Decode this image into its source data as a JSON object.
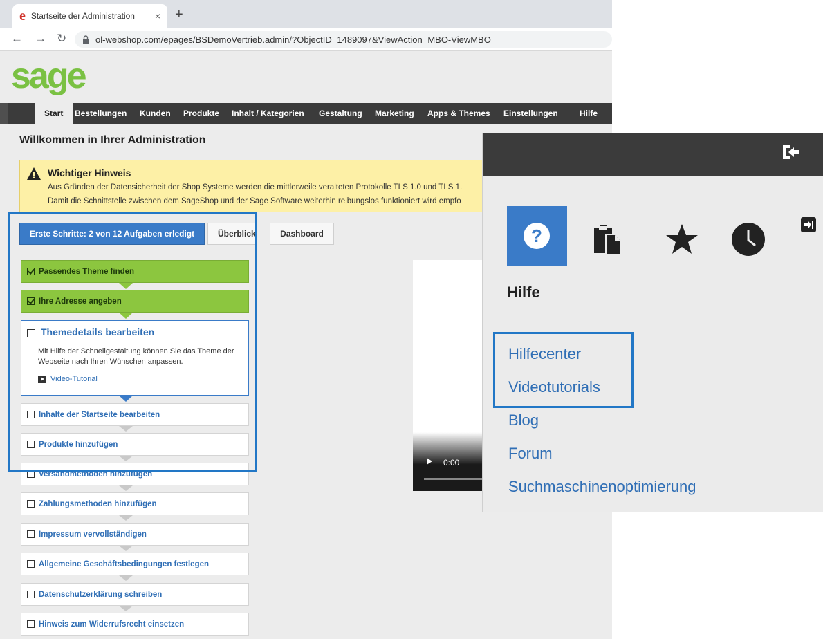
{
  "browser": {
    "tab_title": "Startseite der Administration",
    "tab_favicon": "e",
    "close_glyph": "×",
    "newtab_glyph": "+",
    "url": "ol-webshop.com/epages/BSDemoVertrieb.admin/?ObjectID=1489097&ViewAction=MBO-ViewMBO"
  },
  "logo": "sage",
  "nav": [
    "Start",
    "Bestellungen",
    "Kunden",
    "Produkte",
    "Inhalt / Kategorien",
    "Gestaltung",
    "Marketing",
    "Apps & Themes",
    "Einstellungen",
    "Hilfe"
  ],
  "welcome_title": "Willkommen in Ihrer Administration",
  "notice": {
    "title": "Wichtiger Hinweis",
    "line1": "Aus Gründen der Datensicherheit der Shop Systeme werden die mittlerweile veralteten Protokolle TLS 1.0 und TLS 1.",
    "line2": "Damit die Schnittstelle zwischen dem SageShop und der Sage Software weiterhin reibungslos funktioniert wird empfo"
  },
  "buttons": {
    "steps": "Erste Schritte: 2 von 12 Aufgaben erledigt",
    "overview": "Überblick",
    "dashboard": "Dashboard"
  },
  "steps_done": [
    "Passendes Theme finden",
    "Ihre Adresse angeben"
  ],
  "step_current": {
    "title": "Themedetails bearbeiten",
    "description": "Mit Hilfe der Schnellgestaltung können Sie das Theme der Webseite nach Ihren Wünschen anpassen.",
    "link": "Video-Tutorial"
  },
  "steps_open": [
    "Inhalte der Startseite bearbeiten",
    "Produkte hinzufügen",
    "Versandmethoden hinzufügen",
    "Zahlungsmethoden hinzufügen",
    "Impressum vervollständigen",
    "Allgemeine Geschäftsbedingungen festlegen",
    "Datenschutzerklärung schreiben",
    "Hinweis zum Widerrufsrecht einsetzen"
  ],
  "video": {
    "time": "0:00"
  },
  "help_panel": {
    "heading": "Hilfe",
    "icon_question": "?",
    "links": [
      "Hilfecenter",
      "Videotutorials",
      "Blog",
      "Forum",
      "Suchmaschinenoptimierung"
    ]
  },
  "colors": {
    "accent_blue": "#3a7bc8",
    "done_green": "#8cc63f",
    "logo_green": "#7ac143",
    "notice_yellow": "#fdf0a6",
    "nav_dark": "#3b3b3b"
  }
}
